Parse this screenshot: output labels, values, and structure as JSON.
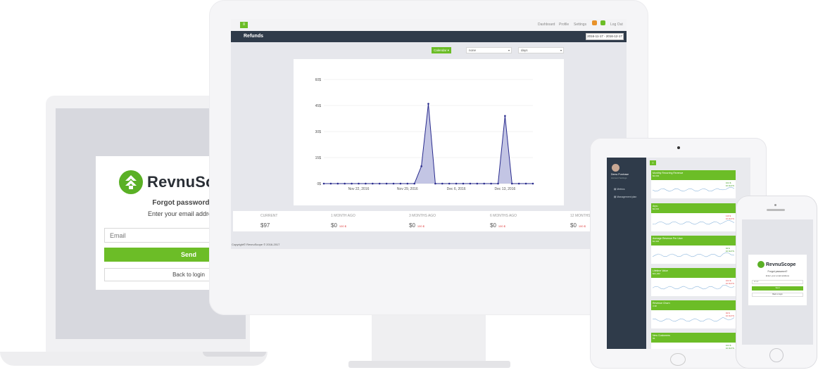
{
  "laptop": {
    "brand": "RevnuScope",
    "title": "Forgot password?",
    "subtitle": "Enter your email address",
    "email_placeholder": "Email",
    "send_label": "Send",
    "back_label": "Back to login"
  },
  "monitor": {
    "nav": [
      "Dashboard",
      "Profile",
      "Settings",
      "Log Out"
    ],
    "page_title": "Refunds",
    "date_range": "2016-11-17 - 2016-12-17",
    "calendar_label": "Calendar",
    "filter_select": "none",
    "period_select": "days",
    "stats": [
      {
        "label": "CURRENT",
        "value": "$97",
        "delta": ""
      },
      {
        "label": "1 MONTH AGO",
        "value": "$0",
        "delta": "100 $"
      },
      {
        "label": "3 MONTHS AGO",
        "value": "$0",
        "delta": "100 $"
      },
      {
        "label": "6 MONTHS AGO",
        "value": "$0",
        "delta": "100 $"
      },
      {
        "label": "12 MONTHS AGO",
        "value": "$0",
        "delta": "100 $"
      }
    ],
    "copyright": "Copyright© RevnuScope © 2016-2017"
  },
  "chart_data": {
    "type": "area",
    "title": "",
    "xlabel": "",
    "ylabel": "",
    "y_ticks": [
      "0$",
      "15$",
      "30$",
      "45$",
      "60$"
    ],
    "ylim": [
      0,
      60
    ],
    "x_tick_labels": [
      "Nov 22, 2016",
      "Nov 29, 2016",
      "Dec 6, 2016",
      "Dec 13, 2016"
    ],
    "x": [
      "Nov 17",
      "Nov 18",
      "Nov 19",
      "Nov 20",
      "Nov 21",
      "Nov 22",
      "Nov 23",
      "Nov 24",
      "Nov 25",
      "Nov 26",
      "Nov 27",
      "Nov 28",
      "Nov 29",
      "Nov 30",
      "Dec 1",
      "Dec 2",
      "Dec 3",
      "Dec 4",
      "Dec 5",
      "Dec 6",
      "Dec 7",
      "Dec 8",
      "Dec 9",
      "Dec 10",
      "Dec 11",
      "Dec 12",
      "Dec 13",
      "Dec 14",
      "Dec 15",
      "Dec 16",
      "Dec 17"
    ],
    "values": [
      0,
      0,
      0,
      0,
      0,
      0,
      0,
      0,
      0,
      0,
      0,
      0,
      0,
      0,
      10,
      46,
      0,
      0,
      0,
      0,
      0,
      0,
      0,
      0,
      0,
      0,
      39,
      0,
      0,
      0,
      0
    ],
    "grid": true,
    "color": "#2a2c8e",
    "fill": "#b9bbdf"
  },
  "tablet": {
    "user_name": "Demo Purchase",
    "user_role": "Account Settings",
    "menu": [
      "Metrics",
      "Management plan"
    ],
    "cards": [
      {
        "title": "Monthly Recurring Revenue",
        "value": "$2,032",
        "delta": "104 $",
        "delta2": "10 DAYS",
        "positive": true
      },
      {
        "title": "Arpu",
        "value": "$2,032",
        "delta": "116 $",
        "delta2": "10 DAYS",
        "positive": false
      },
      {
        "title": "Average Revenue Per User",
        "value": "$1,322",
        "delta": "94 $",
        "delta2": "10 DAYS",
        "positive": true
      },
      {
        "title": "Lifetime Value",
        "value": "$21,322",
        "delta": "104 $",
        "delta2": "10 DAYS",
        "positive": false
      },
      {
        "title": "Revenue Churn",
        "value": "3.38",
        "delta": "94 $",
        "delta2": "10 DAYS",
        "positive": false
      },
      {
        "title": "New Customers",
        "value": "56",
        "delta": "104 $",
        "delta2": "10 DAYS",
        "positive": true
      }
    ]
  },
  "phone": {
    "brand": "RevnuScope",
    "title": "Forgot password?",
    "subtitle": "Enter your email address",
    "email_placeholder": "Email",
    "send_label": "Send",
    "back_label": "Back to login"
  },
  "colors": {
    "accent": "#6cbd27",
    "header": "#2f3b4a",
    "chart_line": "#2a2c8e"
  }
}
